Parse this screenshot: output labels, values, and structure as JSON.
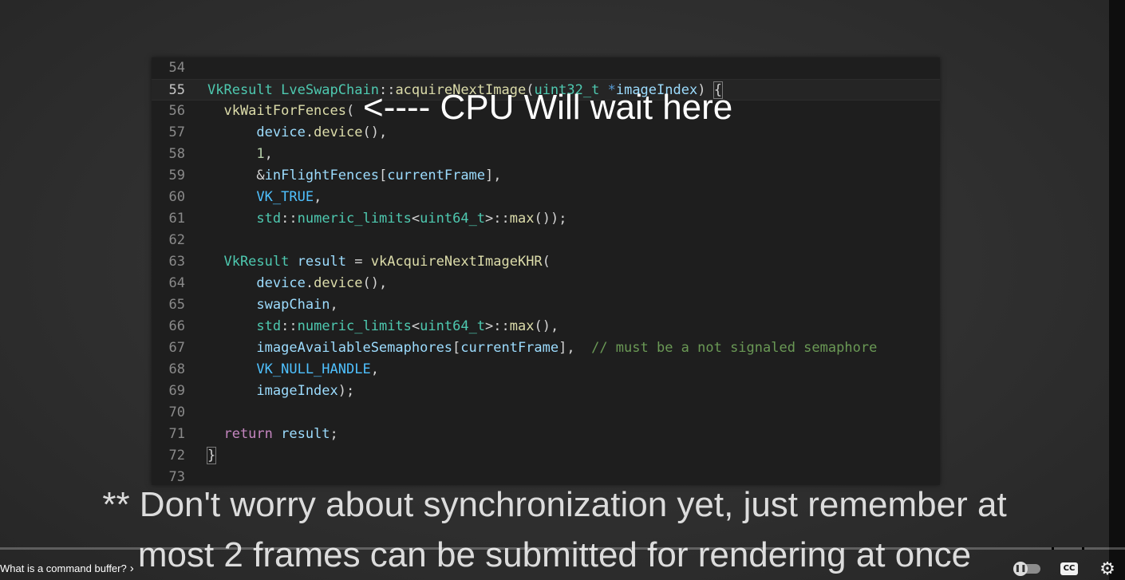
{
  "code": {
    "lines": [
      {
        "n": "54",
        "tokens": []
      },
      {
        "n": "55",
        "current": true,
        "tokens": [
          {
            "t": "VkResult ",
            "c": "type"
          },
          {
            "t": "LveSwapChain",
            "c": "type"
          },
          {
            "t": "::",
            "c": "plain"
          },
          {
            "t": "acquireNextImage",
            "c": "fn"
          },
          {
            "t": "(",
            "c": "plain"
          },
          {
            "t": "uint32_t",
            "c": "type"
          },
          {
            "t": " ",
            "c": "plain"
          },
          {
            "t": "*",
            "c": "ptr"
          },
          {
            "t": "imageIndex",
            "c": "var"
          },
          {
            "t": ") ",
            "c": "plain"
          },
          {
            "t": "{",
            "c": "brace"
          }
        ]
      },
      {
        "n": "56",
        "tokens": [
          {
            "t": "  vkWaitForFences",
            "c": "fn"
          },
          {
            "t": "(",
            "c": "plain"
          }
        ]
      },
      {
        "n": "57",
        "tokens": [
          {
            "t": "      device",
            "c": "var"
          },
          {
            "t": ".",
            "c": "plain"
          },
          {
            "t": "device",
            "c": "fn"
          },
          {
            "t": "(),",
            "c": "plain"
          }
        ]
      },
      {
        "n": "58",
        "tokens": [
          {
            "t": "      1",
            "c": "num"
          },
          {
            "t": ",",
            "c": "plain"
          }
        ]
      },
      {
        "n": "59",
        "tokens": [
          {
            "t": "      &",
            "c": "plain"
          },
          {
            "t": "inFlightFences",
            "c": "var"
          },
          {
            "t": "[",
            "c": "plain"
          },
          {
            "t": "currentFrame",
            "c": "var"
          },
          {
            "t": "],",
            "c": "plain"
          }
        ]
      },
      {
        "n": "60",
        "tokens": [
          {
            "t": "      VK_TRUE",
            "c": "const"
          },
          {
            "t": ",",
            "c": "plain"
          }
        ]
      },
      {
        "n": "61",
        "tokens": [
          {
            "t": "      std",
            "c": "type"
          },
          {
            "t": "::",
            "c": "plain"
          },
          {
            "t": "numeric_limits",
            "c": "type"
          },
          {
            "t": "<",
            "c": "plain"
          },
          {
            "t": "uint64_t",
            "c": "type"
          },
          {
            "t": ">::",
            "c": "plain"
          },
          {
            "t": "max",
            "c": "fn"
          },
          {
            "t": "());",
            "c": "plain"
          }
        ]
      },
      {
        "n": "62",
        "tokens": []
      },
      {
        "n": "63",
        "tokens": [
          {
            "t": "  VkResult ",
            "c": "type"
          },
          {
            "t": "result",
            "c": "var"
          },
          {
            "t": " = ",
            "c": "plain"
          },
          {
            "t": "vkAcquireNextImageKHR",
            "c": "fn"
          },
          {
            "t": "(",
            "c": "plain"
          }
        ]
      },
      {
        "n": "64",
        "tokens": [
          {
            "t": "      device",
            "c": "var"
          },
          {
            "t": ".",
            "c": "plain"
          },
          {
            "t": "device",
            "c": "fn"
          },
          {
            "t": "(),",
            "c": "plain"
          }
        ]
      },
      {
        "n": "65",
        "tokens": [
          {
            "t": "      swapChain",
            "c": "var"
          },
          {
            "t": ",",
            "c": "plain"
          }
        ]
      },
      {
        "n": "66",
        "tokens": [
          {
            "t": "      std",
            "c": "type"
          },
          {
            "t": "::",
            "c": "plain"
          },
          {
            "t": "numeric_limits",
            "c": "type"
          },
          {
            "t": "<",
            "c": "plain"
          },
          {
            "t": "uint64_t",
            "c": "type"
          },
          {
            "t": ">::",
            "c": "plain"
          },
          {
            "t": "max",
            "c": "fn"
          },
          {
            "t": "(),",
            "c": "plain"
          }
        ]
      },
      {
        "n": "67",
        "tokens": [
          {
            "t": "      imageAvailableSemaphores",
            "c": "var"
          },
          {
            "t": "[",
            "c": "plain"
          },
          {
            "t": "currentFrame",
            "c": "var"
          },
          {
            "t": "],  ",
            "c": "plain"
          },
          {
            "t": "// must be a not signaled semaphore",
            "c": "comment"
          }
        ]
      },
      {
        "n": "68",
        "tokens": [
          {
            "t": "      VK_NULL_HANDLE",
            "c": "const"
          },
          {
            "t": ",",
            "c": "plain"
          }
        ]
      },
      {
        "n": "69",
        "tokens": [
          {
            "t": "      imageIndex",
            "c": "var"
          },
          {
            "t": ");",
            "c": "plain"
          }
        ]
      },
      {
        "n": "70",
        "tokens": []
      },
      {
        "n": "71",
        "tokens": [
          {
            "t": "  return ",
            "c": "kw"
          },
          {
            "t": "result",
            "c": "var"
          },
          {
            "t": ";",
            "c": "plain"
          }
        ]
      },
      {
        "n": "72",
        "tokens": [
          {
            "t": "}",
            "c": "brace"
          }
        ]
      },
      {
        "n": "73",
        "tokens": []
      }
    ]
  },
  "overlay": {
    "arrow_text": "<---- CPU Will wait here"
  },
  "captions": {
    "line1": "** Don't worry about synchronization yet, just remember at",
    "line2": "most 2 frames can be submitted for rendering at once"
  },
  "player": {
    "chapter_title": "What is a command buffer?",
    "chevron": "›",
    "autoplay_icon": "pause-icon",
    "cc_label": "CC",
    "settings_icon": "gear-icon"
  },
  "colors": {
    "editor_bg": "#1e1e1e",
    "type": "#4ec9b0",
    "function": "#dcdcaa",
    "variable": "#9cdcfe",
    "constant": "#4fc1ff",
    "comment": "#6a9955",
    "keyword": "#c586c0"
  }
}
